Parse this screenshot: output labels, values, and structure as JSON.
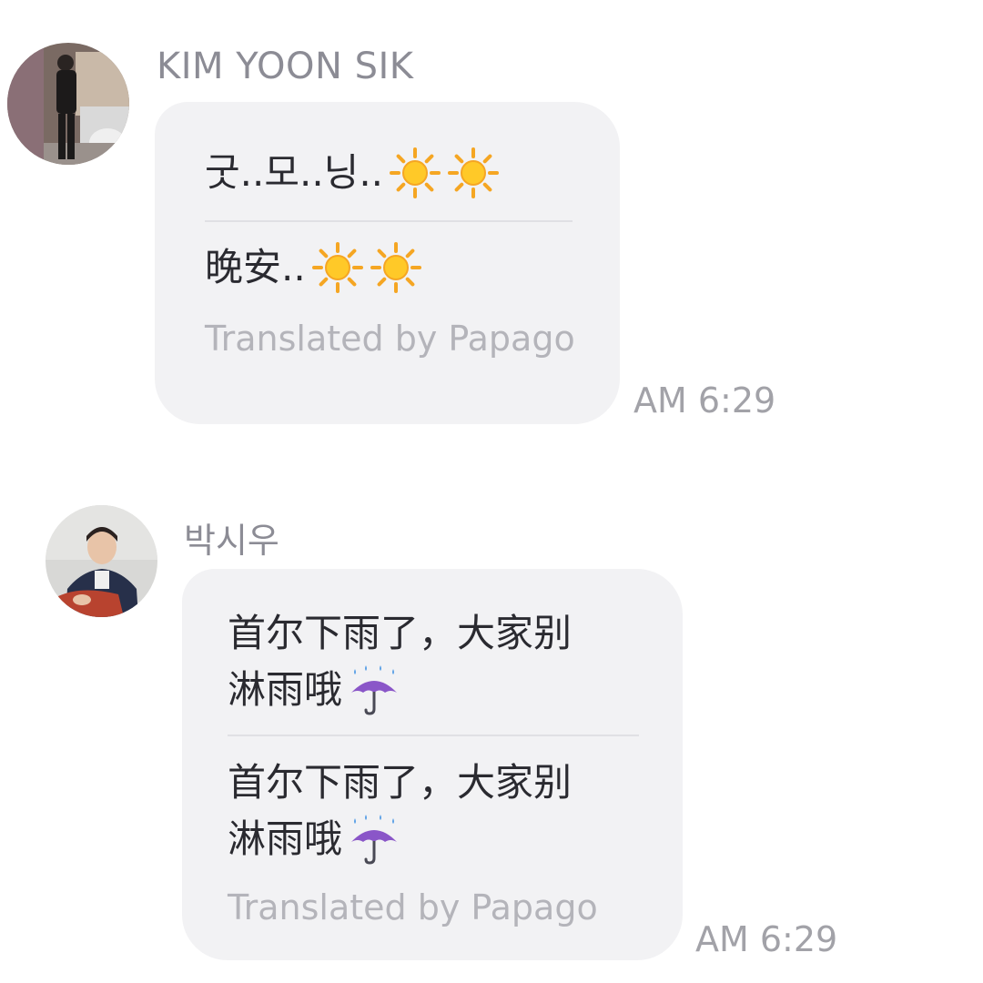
{
  "messages": [
    {
      "sender": "KIM YOON SIK",
      "original_text": "굿..모..닝..",
      "original_icons": [
        "sun-icon",
        "sun-icon"
      ],
      "translated_text": "晚安..",
      "translated_icons": [
        "sun-icon",
        "sun-icon"
      ],
      "translated_by": "Translated by Papago",
      "time": "AM 6:29"
    },
    {
      "sender": "박시우",
      "original_lines": [
        "首尔下雨了，大家别",
        "淋雨哦"
      ],
      "original_icons": [
        "umbrella-with-rain-icon"
      ],
      "translated_lines": [
        "首尔下雨了，大家别",
        "淋雨哦"
      ],
      "translated_icons": [
        "umbrella-with-rain-icon"
      ],
      "translated_by": "Translated by Papago",
      "time": "AM 6:29"
    }
  ],
  "colors": {
    "bubble": "#f2f2f4",
    "name": "#8c8c95",
    "message": "#2a2a30",
    "muted": "#b4b4ba",
    "divider": "#e0e0e4"
  }
}
